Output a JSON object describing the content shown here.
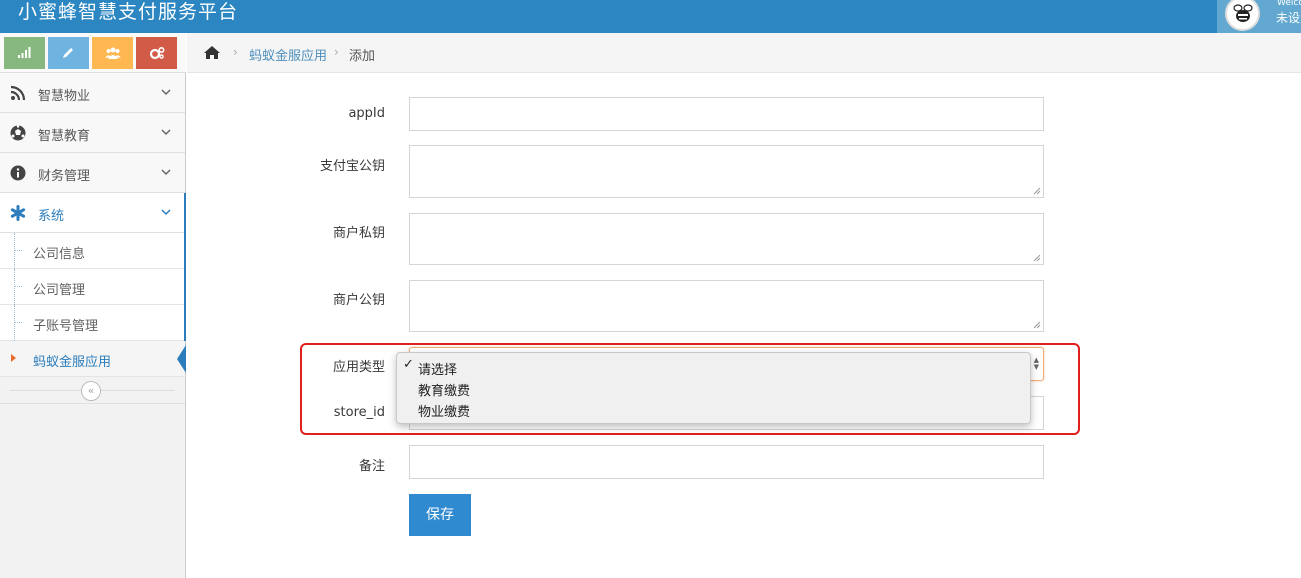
{
  "app": {
    "title": "小蜜蜂智慧支付服务平台",
    "user_welcome": "Welcome,",
    "user_name": "未设置"
  },
  "shortcuts": [
    {
      "name": "signal-icon",
      "color": "#87b87f"
    },
    {
      "name": "pencil-icon",
      "color": "#6fb3e0"
    },
    {
      "name": "users-icon",
      "color": "#ffb752"
    },
    {
      "name": "cogs-icon",
      "color": "#d15b47"
    }
  ],
  "sidebar": {
    "items": [
      {
        "label": "智慧物业",
        "icon": "rss-icon"
      },
      {
        "label": "智慧教育",
        "icon": "soccer-ball-icon"
      },
      {
        "label": "财务管理",
        "icon": "info-circle-icon"
      },
      {
        "label": "系统",
        "icon": "asterisk-icon"
      }
    ],
    "sub_items": [
      {
        "label": "公司信息"
      },
      {
        "label": "公司管理"
      },
      {
        "label": "子账号管理"
      },
      {
        "label": "蚂蚁金服应用"
      }
    ],
    "collapse_glyph": "«"
  },
  "breadcrumb": {
    "link": "蚂蚁金服应用",
    "current": "添加",
    "separator": "›"
  },
  "form": {
    "appid_label": "appId",
    "appid_value": "",
    "alipay_pubkey_label": "支付宝公钥",
    "merchant_privkey_label": "商户私钥",
    "merchant_pubkey_label": "商户公钥",
    "app_type_label": "应用类型",
    "store_id_label": "store_id",
    "store_id_value": "",
    "remark_label": "备注",
    "remark_value": "",
    "save_label": "保存"
  },
  "dropdown": {
    "check": "✓",
    "options": [
      "请选择",
      "教育缴费",
      "物业缴费"
    ],
    "selected": "请选择"
  },
  "colors": {
    "navbar": "#2b86c1",
    "accent": "#2b7dbc",
    "highlight": "#e0201c",
    "save_button": "#2f8ad0"
  }
}
